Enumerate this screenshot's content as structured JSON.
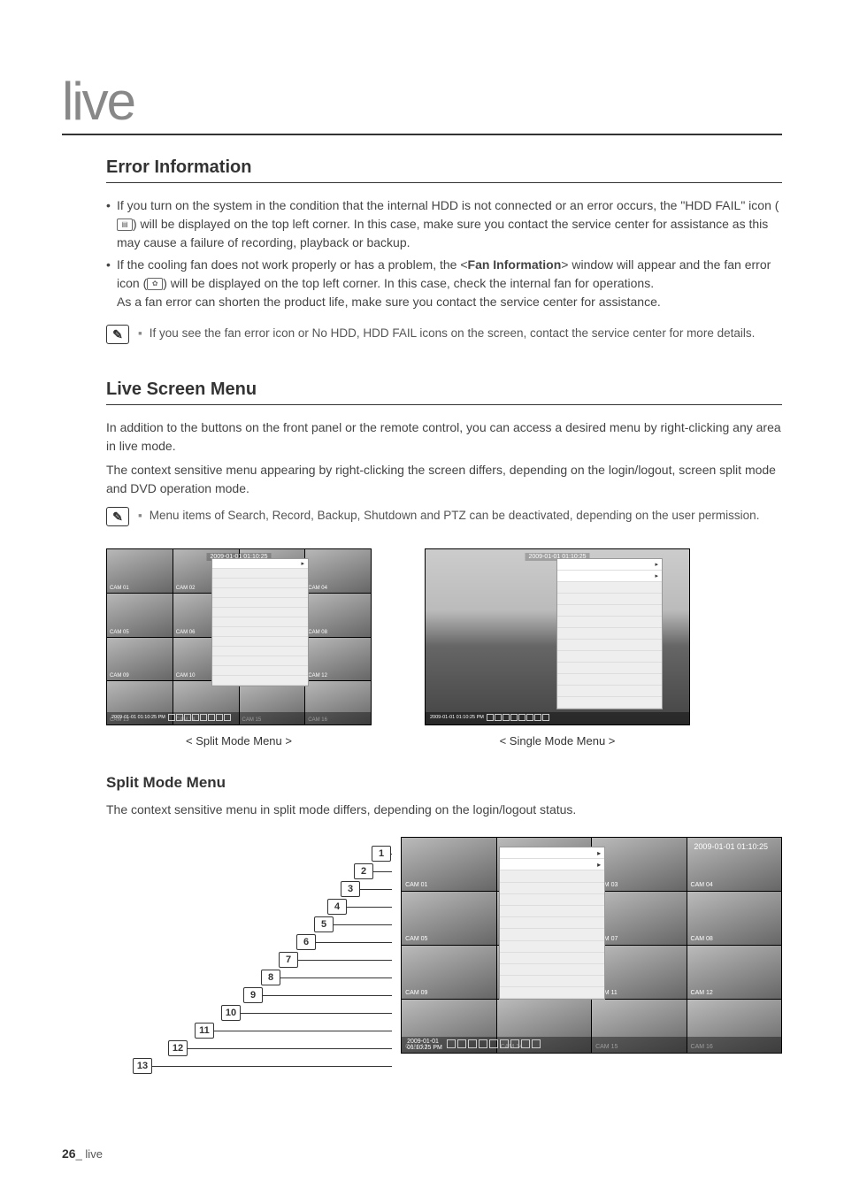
{
  "page": {
    "title": "live",
    "footer_number": "26",
    "footer_label": "live"
  },
  "sections": {
    "error": {
      "heading": "Error Information",
      "bullets": [
        "If you turn on the system in the condition that the internal HDD is not connected or an error occurs, the \"HDD FAIL\" icon ( ⌸ ) will be displayed on the top left corner. In this case, make sure you contact the service center for assistance as this may cause a failure of recording, playback or backup.",
        "If the cooling fan does not work properly or has a problem, the <Fan Information> window will appear and the fan error icon ( ❀ ) will be displayed on the top left corner. In this case, check the internal fan for operations.\nAs a fan error can shorten the product life, make sure you contact the service center for assistance."
      ],
      "note": "If you see the fan error icon or No HDD, HDD FAIL icons on the screen, contact the service center for more details."
    },
    "live_menu": {
      "heading": "Live Screen Menu",
      "p1": "In addition to the buttons on the front panel or the remote control, you can access a desired menu by right-clicking any area in live mode.",
      "p2": "The context sensitive menu appearing by right-clicking the screen differs, depending on the login/logout, screen split mode and DVD operation mode.",
      "note": "Menu items of Search, Record, Backup, Shutdown and PTZ can be deactivated, depending on the user permission.",
      "split_caption": "< Split Mode Menu >",
      "single_caption": "< Single Mode Menu >"
    },
    "split_mode": {
      "heading": "Split Mode Menu",
      "p1": "The context sensitive menu in split mode differs, depending on the login/logout status."
    }
  },
  "screenshots": {
    "timestamp_top": "2009-01-01 01:10:25",
    "timestamp_bottom": "2009-01-01\n01:10:25 PM",
    "cams": [
      "CAM 01",
      "CAM 02",
      "CAM 03",
      "CAM 04",
      "CAM 05",
      "CAM 06",
      "CAM 07",
      "CAM 08",
      "CAM 09",
      "CAM 10",
      "CAM 11",
      "CAM 12",
      "CAM 13",
      "CAM 14",
      "CAM 15",
      "CAM 16"
    ]
  },
  "callouts": [
    "1",
    "2",
    "3",
    "4",
    "5",
    "6",
    "7",
    "8",
    "9",
    "10",
    "11",
    "12",
    "13"
  ]
}
